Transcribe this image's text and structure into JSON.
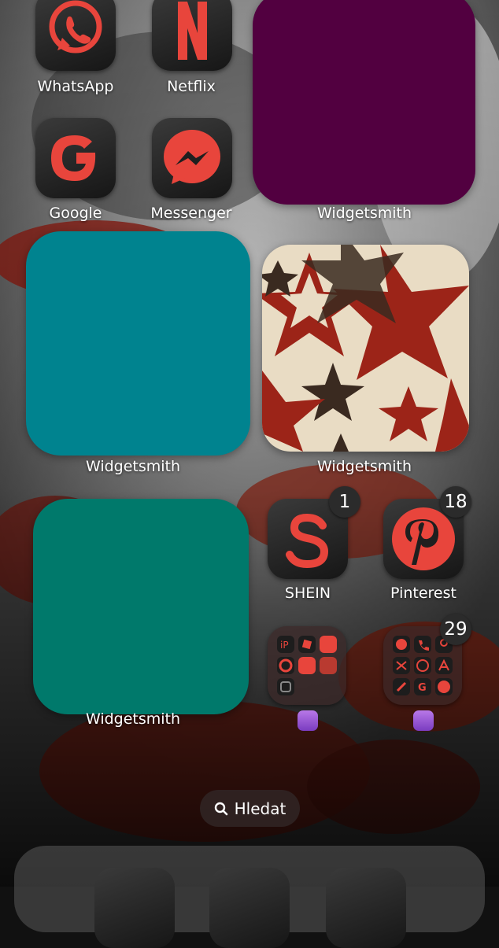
{
  "home": {
    "apps": {
      "whatsapp": {
        "label": "WhatsApp",
        "icon": "whatsapp-icon"
      },
      "netflix": {
        "label": "Netflix",
        "icon": "netflix-icon"
      },
      "google": {
        "label": "Google",
        "icon": "google-icon"
      },
      "messenger": {
        "label": "Messenger",
        "icon": "messenger-icon"
      },
      "shein": {
        "label": "SHEIN",
        "icon": "shein-icon",
        "badge": "1"
      },
      "pinterest": {
        "label": "Pinterest",
        "icon": "pinterest-icon",
        "badge": "18"
      }
    },
    "widgets": {
      "w1": {
        "label": "Widgetsmith",
        "color": "#520040"
      },
      "w2": {
        "label": "Widgetsmith",
        "color": "#00838F"
      },
      "w3": {
        "label": "Widgetsmith",
        "content": "stars-pattern"
      },
      "w4": {
        "label": "Widgetsmith",
        "color": "#00796B"
      }
    },
    "folders": {
      "f1": {
        "icon": "yin-yang-icon",
        "badge": ""
      },
      "f2": {
        "icon": "yin-yang-icon",
        "badge": "29"
      }
    },
    "search": {
      "label": "Hledat",
      "icon": "magnifier-icon"
    }
  },
  "colors": {
    "accent": "#E8453C",
    "icon_bg": "#1f1f1f"
  }
}
